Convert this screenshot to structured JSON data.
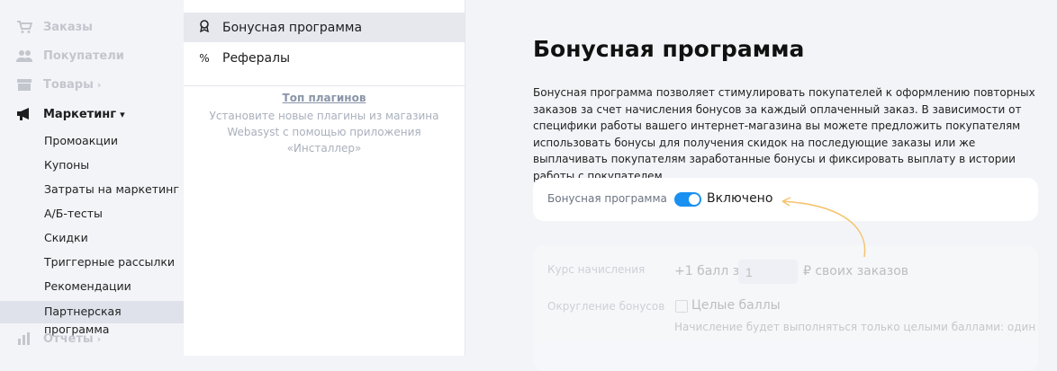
{
  "sidebar": {
    "items": [
      {
        "label": "Заказы",
        "icon": "cart-icon"
      },
      {
        "label": "Покупатели",
        "icon": "users-icon"
      },
      {
        "label": "Товары",
        "icon": "box-icon",
        "chevron": "›"
      },
      {
        "label": "Маркетинг",
        "icon": "megaphone-icon",
        "chevron": "▾"
      },
      {
        "label": "Отчеты",
        "icon": "chart-icon",
        "chevron": "›"
      }
    ],
    "marketing_sub": [
      "Промоакции",
      "Купоны",
      "Затраты на маркетинг",
      "А/Б-тесты",
      "Скидки",
      "Триггерные рассылки",
      "Рекомендации",
      "Партнерская программа"
    ]
  },
  "plugins": {
    "items": [
      {
        "label": "Бонусная программа",
        "icon": "ribbon-icon",
        "glyph": "🎗"
      },
      {
        "label": "Рефералы",
        "icon": "percent-icon",
        "glyph": "%"
      }
    ],
    "top_link": "Топ плагинов",
    "top_desc": "Установите новые плагины из магазина Webasyst с помощью приложения «Инсталлер»"
  },
  "main": {
    "title": "Бонусная программа",
    "description": "Бонусная программа позволяет стимулировать покупателей к оформлению повторных заказов за счет начисления бонусов за каждый оплаченный заказ. В зависимости от специфики работы вашего интернет-магазина вы можете предложить покупателям использовать бонусы для получения скидок на последующие заказы или же выплачивать покупателям заработанные бонусы и фиксировать выплату в истории работы с покупателем.",
    "toggle": {
      "label": "Бонусная программа",
      "state_text": "Включено",
      "on": true
    },
    "rate": {
      "label": "Курс начисления",
      "prefix": "+1 балл за",
      "value": "1",
      "suffix": "₽ своих заказов"
    },
    "rounding": {
      "label": "Округление бонусов",
      "checkbox_label": "Целые баллы",
      "hint": "Начисление будет выполняться только целыми баллами: один"
    }
  },
  "colors": {
    "accent": "#1a90f0",
    "arrow": "#f5c36c"
  }
}
